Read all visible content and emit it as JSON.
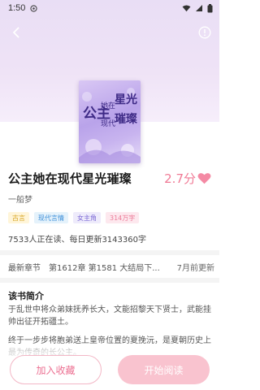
{
  "status_bar": {
    "time": "1:50",
    "icons": [
      "notification-icon",
      "wifi-icon",
      "signal-icon",
      "battery-icon"
    ]
  },
  "header": {
    "back_icon": "chevron-left-icon",
    "info_icon": "info-circle-icon"
  },
  "cover": {
    "lines": [
      "公主",
      "她在",
      "现代",
      "星光",
      "璀璨"
    ]
  },
  "book": {
    "title": "公主她在现代星光璀璨",
    "rating": "2.7分",
    "author": "一船梦",
    "tags": [
      "古言",
      "现代言情",
      "女主角",
      "314万字"
    ],
    "stats": "7533人正在读、每日更新3143360字"
  },
  "latest_chapter": {
    "label": "最新章节",
    "title": "第1612章 第1581 大结局下...",
    "time": "7月前更新"
  },
  "intro": {
    "title": "该书简介",
    "paragraphs": [
      "于乱世中将众弟妹抚养长大，文能招黎天下贤士，武能挂帅出征开拓疆土。",
      "终于一步步将胞弟送上皇帝位置的夏挽沅，是夏朝历史上最为传奇的长公主。"
    ]
  },
  "actions": {
    "collect_label": "加入收藏",
    "read_label": "开始阅读"
  },
  "colors": {
    "accent": "#f07a95",
    "hero_bg": "#ebdff5"
  }
}
